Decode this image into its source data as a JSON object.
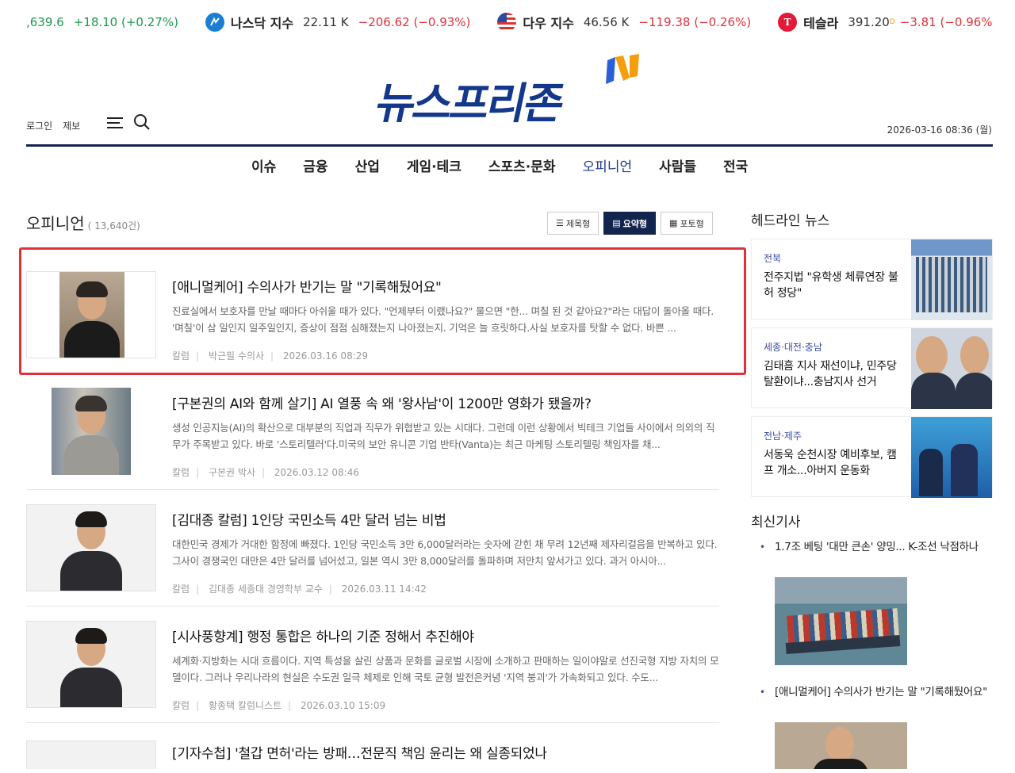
{
  "ticker": [
    {
      "name": "",
      "value": ",639.6",
      "change": "+18.10 (+0.27%)",
      "dir": "up",
      "icon": "none"
    },
    {
      "name": "나스닥 지수",
      "value": "22.11 K",
      "change": "−206.62 (−0.93%)",
      "dir": "down",
      "icon": "nasdaq-icon"
    },
    {
      "name": "다우 지수",
      "value": "46.56 K",
      "change": "−119.38 (−0.26%)",
      "dir": "down",
      "icon": "us-flag-icon"
    },
    {
      "name": "테슬라",
      "value": "391.20",
      "sup": "D",
      "change": "−3.81 (−0.96%)",
      "dir": "down",
      "icon": "tesla-icon"
    }
  ],
  "logo": {
    "text": "뉴스프리존"
  },
  "util": {
    "login": "로그인",
    "report": "제보"
  },
  "date": "2026-03-16 08:36 (월)",
  "nav": [
    "이슈",
    "금융",
    "산업",
    "게임·테크",
    "스포츠·문화",
    "오피니언",
    "사람들",
    "전국"
  ],
  "nav_active": "오피니언",
  "section": {
    "title": "오피니언",
    "count": "( 13,640건)"
  },
  "views": {
    "title": "제목형",
    "summary": "요약형",
    "photo": "포토형"
  },
  "articles": [
    {
      "title": "[애니멀케어] 수의사가 반기는 말 \"기록해뒀어요\"",
      "summary": "진료실에서 보호자를 만날 때마다 아쉬울 때가 있다. \"언제부터 이랬나요?\" 물으면 \"한... 며칠 된 것 같아요?\"라는 대답이 돌아올 때다. '며칠'이 삼 일인지 일주일인지, 증상이 점점 심해졌는지 나아졌는지. 기억은 늘 흐릿하다.사실 보호자를 탓할 수 없다. 바쁜 ...",
      "category": "칼럼",
      "author": "박근필 수의사",
      "date": "2026.03.16 08:29"
    },
    {
      "title": "[구본권의 AI와 함께 살기] AI 열풍 속 왜 '왕사남'이 1200만 영화가 됐을까?",
      "summary": "생성 인공지능(AI)의 확산으로 대부분의 직업과 직무가 위협받고 있는 시대다. 그런데 이런 상황에서 빅테크 기업들 사이에서 의외의 직무가 주목받고 있다. 바로 '스토리텔러'다.미국의 보안 유니콘 기업 반타(Vanta)는 최근 마케팅 스토리텔링 책임자를 채...",
      "category": "칼럼",
      "author": "구본권 박사",
      "date": "2026.03.12 08:46"
    },
    {
      "title": "[김대종 칼럼] 1인당 국민소득 4만 달러 넘는 비법",
      "summary": "대한민국 경제가 거대한 함정에 빠졌다. 1인당 국민소득 3만 6,000달러라는 숫자에 갇힌 채 무려 12년째 제자리걸음을 반복하고 있다. 그사이 경쟁국인 대만은 4만 달러를 넘어섰고, 일본 역시 3만 8,000달러를 돌파하며 저만치 앞서가고 있다. 과거 아시아...",
      "category": "칼럼",
      "author": "김대종 세종대 경영학부 교수",
      "date": "2026.03.11 14:42"
    },
    {
      "title": "[시사풍향계] 행정 통합은 하나의 기준 정해서 추진해야",
      "summary": "세계화·지방화는 시대 흐름이다. 지역 특성을 살린 상품과 문화를 글로벌 시장에 소개하고 판매하는 일이야말로 선진국형 지방 자치의 모델이다. 그러나 우리나라의 현실은 수도권 일극 체제로 인해 국토 균형 발전은커녕 '지역 붕괴'가 가속화되고 있다. 수도...",
      "category": "칼럼",
      "author": "황종택 칼럼니스트",
      "date": "2026.03.10 15:09"
    },
    {
      "title": "[기자수첩] '철갑 면허'라는 방패…전문직 책임 윤리는 왜 실종되었나",
      "summary": "",
      "category": "",
      "author": "",
      "date": ""
    }
  ],
  "right": {
    "headline_title": "헤드라인 뉴스",
    "headlines": [
      {
        "category": "전북",
        "title": "전주지법 \"유학생 체류연장 불허 정당\""
      },
      {
        "category": "세종·대전·충남",
        "title": "김태흠 지사 재선이냐, 민주당 탈환이냐...충남지사 선거"
      },
      {
        "category": "전남·제주",
        "title": "서동욱 순천시장 예비후보, 캠프 개소...아버지 운동화"
      }
    ],
    "latest_title": "최신기사",
    "latest": [
      {
        "title": "1.7조 베팅 '대만 큰손' 양밍... K-조선 낙점하나"
      },
      {
        "title": "[애니멀케어] 수의사가 반기는 말 \"기록해뒀어요\""
      }
    ]
  },
  "colors": {
    "navy": "#13244d",
    "brand_blue": "#13378a",
    "accent_orange": "#f59e0b",
    "up": "#1a9a50",
    "down": "#e0313b"
  }
}
